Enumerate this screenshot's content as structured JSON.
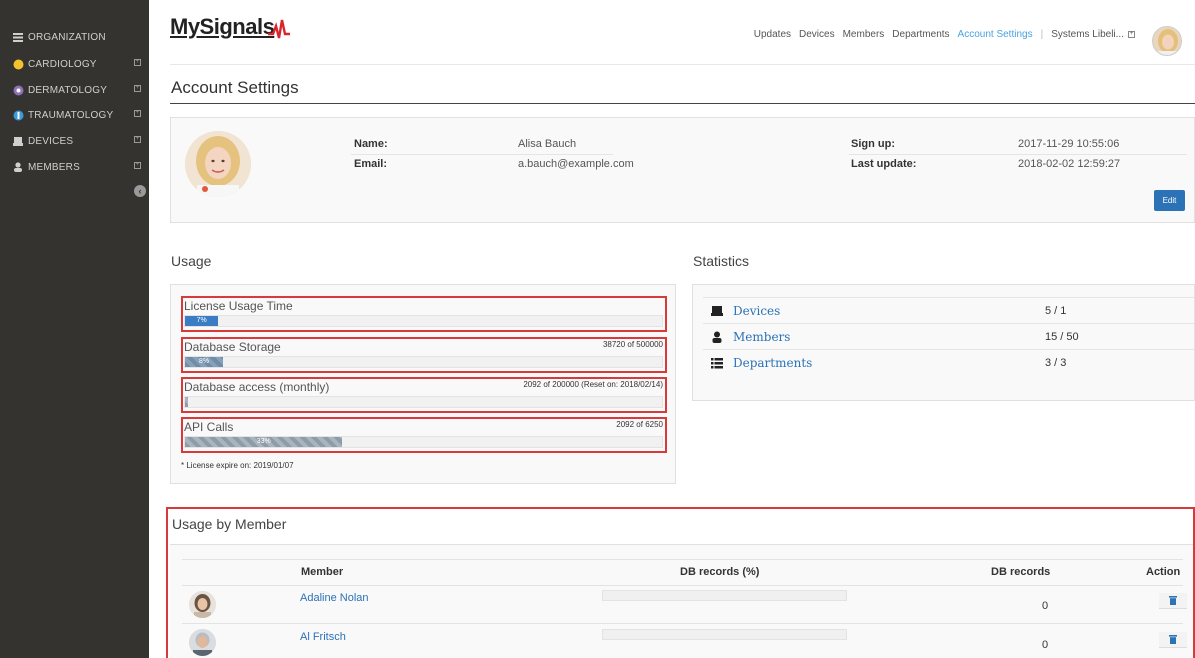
{
  "sidebar": {
    "items": [
      {
        "label": "ORGANIZATION",
        "icon": "list-icon"
      },
      {
        "label": "CARDIOLOGY",
        "icon": "yellow-dot-icon",
        "color": "#f3c12b"
      },
      {
        "label": "DERMATOLOGY",
        "icon": "purple-dot-icon",
        "color": "#8e6fb8"
      },
      {
        "label": "TRAUMATOLOGY",
        "icon": "blue-dot-icon",
        "color": "#3d9ad8"
      },
      {
        "label": "DEVICES",
        "icon": "device-icon"
      },
      {
        "label": "MEMBERS",
        "icon": "user-icon"
      }
    ]
  },
  "header": {
    "logo": "MySignals",
    "nav": [
      "Updates",
      "Devices",
      "Members",
      "Departments",
      "Account Settings",
      "Systems Libeli..."
    ],
    "active": "Account Settings"
  },
  "page_title": "Account Settings",
  "profile": {
    "name_label": "Name:",
    "name": "Alisa Bauch",
    "email_label": "Email:",
    "email": "a.bauch@example.com",
    "signup_label": "Sign up:",
    "signup": "2017-11-29 10:55:06",
    "update_label": "Last update:",
    "update": "2018-02-02 12:59:27",
    "edit_label": "Edit"
  },
  "usage": {
    "title": "Usage",
    "meters": [
      {
        "label": "License Usage Time",
        "right": "",
        "percent": 7,
        "percent_label": "7%"
      },
      {
        "label": "Database Storage",
        "right": "38720 of 500000",
        "percent": 8,
        "percent_label": "8%"
      },
      {
        "label": "Database access (monthly)",
        "right": "2092 of 200000 (Reset on: 2018/02/14)",
        "percent": 1,
        "percent_label": ""
      },
      {
        "label": "API Calls",
        "right": "2092 of 6250",
        "percent": 33,
        "percent_label": "33%"
      }
    ],
    "license_note": "* License expire on: 2019/01/07"
  },
  "statistics": {
    "title": "Statistics",
    "rows": [
      {
        "name": "Devices",
        "value": "5 / 1"
      },
      {
        "name": "Members",
        "value": "15 / 50"
      },
      {
        "name": "Departments",
        "value": "3 / 3"
      }
    ]
  },
  "usage_by_member": {
    "title": "Usage by Member",
    "headers": {
      "member": "Member",
      "db_pct": "DB records (%)",
      "db_rec": "DB records",
      "action": "Action"
    },
    "rows": [
      {
        "name": "Adaline Nolan",
        "records": "0",
        "percent": 0
      },
      {
        "name": "Al Fritsch",
        "records": "0",
        "percent": 0
      }
    ]
  }
}
